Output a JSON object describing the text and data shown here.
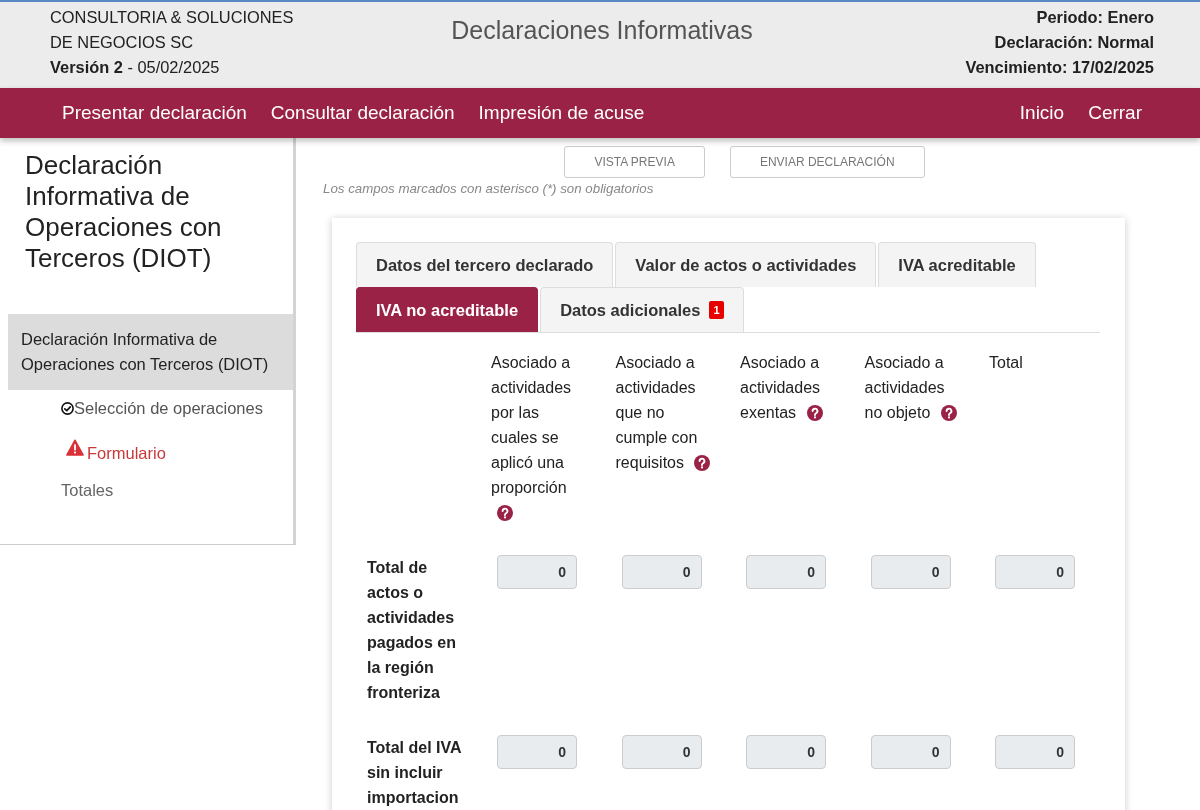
{
  "header": {
    "company": "CONSULTORIA & SOLUCIONES DE NEGOCIOS SC",
    "version": "**Versión 2** - 05/02/2025",
    "title": "Declaraciones Informativas",
    "info": [
      "Periodo: Enero",
      "Declaración: Normal",
      "Vencimiento: 17/02/2025"
    ]
  },
  "navbar": {
    "left": [
      "Presentar declaración",
      "Consultar declaración",
      "Impresión de acuse"
    ],
    "right": [
      "Inicio",
      "Cerrar"
    ]
  },
  "sidebar": {
    "title": "Declaración Informativa de Operaciones con Terceros (DIOT)",
    "items": [
      {
        "label": "Declaración Informativa de Operaciones con Terceros (DIOT)",
        "selected": true,
        "children": [
          {
            "label": "Selección de operaciones",
            "kind": "complete",
            "selected": false
          },
          {
            "label": "Formulario",
            "kind": "error",
            "selected": false
          },
          {
            "label": "Totales",
            "kind": "pending",
            "selected": false
          }
        ]
      }
    ]
  },
  "actions": [
    "VISTA PREVIA",
    "ENVIAR DECLARACIÓN"
  ],
  "note": "Los campos marcados con asterisco (*) son obligatorios",
  "tabs": [
    {
      "label": "Datos del tercero declarado",
      "selected": false
    },
    {
      "label": "Valor de actos o actividades",
      "selected": false
    },
    {
      "label": "IVA acreditable",
      "selected": false
    },
    {
      "label": "IVA no acreditable",
      "selected": true
    },
    {
      "label": "Datos adicionales",
      "selected": false,
      "badge": "1"
    }
  ],
  "table": {
    "columns": [
      {
        "label": "Asociado a actividades por las cuales se aplicó una proporción",
        "help": true
      },
      {
        "label": "Asociado a actividades que no cumple con requisitos",
        "help": true
      },
      {
        "label": "Asociado a actividades exentas",
        "help": true
      },
      {
        "label": "Asociado a actividades no objeto",
        "help": true
      },
      {
        "label": "Total",
        "help": false
      }
    ],
    "rows": [
      {
        "label": "Total de actos o actividades pagados en la región fronteriza",
        "cells": [
          {
            "value": "0",
            "disabled": true
          },
          {
            "value": "0",
            "disabled": true
          },
          {
            "value": "0",
            "disabled": true
          },
          {
            "value": "0",
            "disabled": true
          },
          {
            "value": "0",
            "disabled": true
          }
        ]
      },
      {
        "label": "Total del IVA sin incluir importacion",
        "cells": [
          {
            "value": "0",
            "disabled": true
          },
          {
            "value": "0",
            "disabled": true
          },
          {
            "value": "0",
            "disabled": true
          },
          {
            "value": "0",
            "disabled": true
          },
          {
            "value": "0",
            "disabled": true
          }
        ]
      }
    ]
  }
}
